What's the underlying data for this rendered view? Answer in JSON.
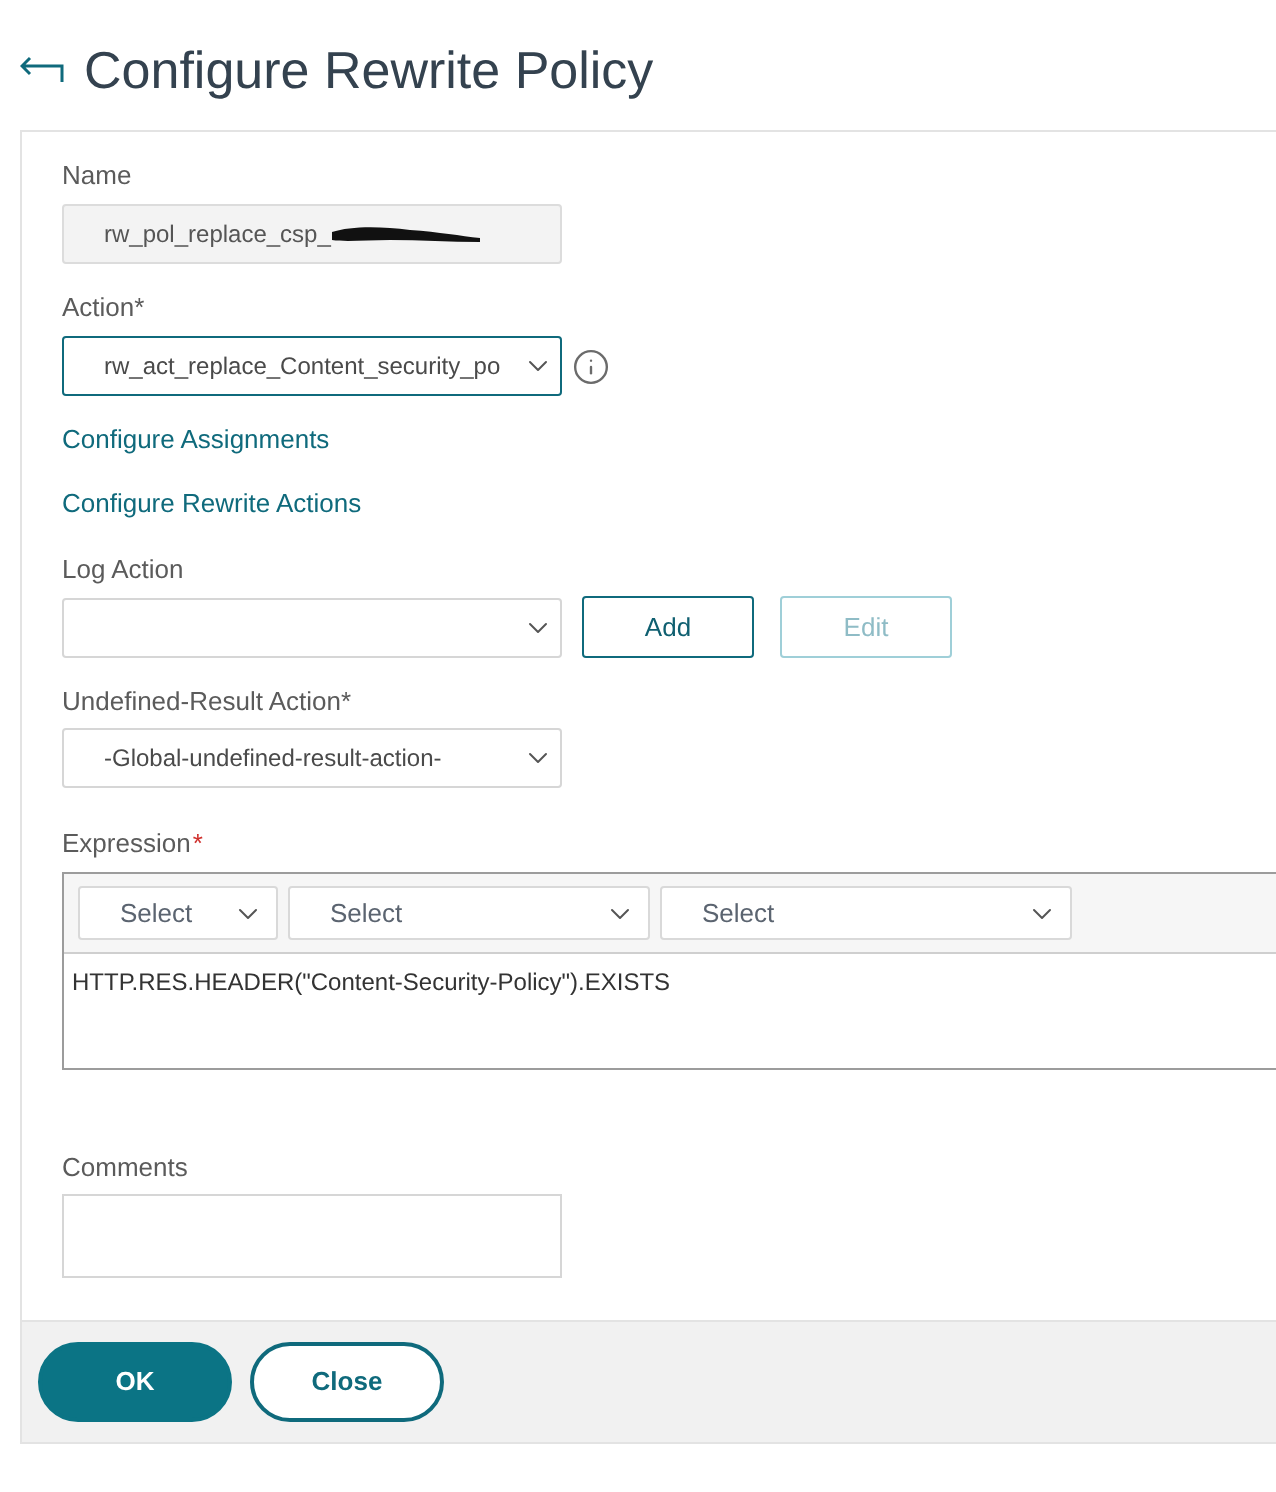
{
  "header": {
    "title": "Configure Rewrite Policy"
  },
  "name_field": {
    "label": "Name",
    "value": "rw_pol_replace_csp_",
    "disabled": true,
    "redacted": true
  },
  "action_field": {
    "label": "Action*",
    "value": "rw_act_replace_Content_security_po",
    "focused": true
  },
  "links": [
    "Configure Assignments",
    "Configure Rewrite Actions"
  ],
  "log_action": {
    "label": "Log Action",
    "buttons": [
      {
        "label": "Add",
        "disabled": false
      },
      {
        "label": "Edit",
        "disabled": true
      }
    ]
  },
  "undefined_result_action": {
    "label": "Undefined-Result Action*",
    "value": "-Global-undefined-result-action-"
  },
  "expression": {
    "label": "Expression",
    "required_mark": "*",
    "selects": [
      "Select",
      "Select",
      "Select"
    ],
    "value": "HTTP.RES.HEADER(\"Content-Security-Policy\").EXISTS"
  },
  "comments": {
    "label": "Comments"
  },
  "footer": {
    "buttons": [
      {
        "label": "OK",
        "kind": "primary"
      },
      {
        "label": "Close",
        "kind": "secondary"
      }
    ]
  }
}
